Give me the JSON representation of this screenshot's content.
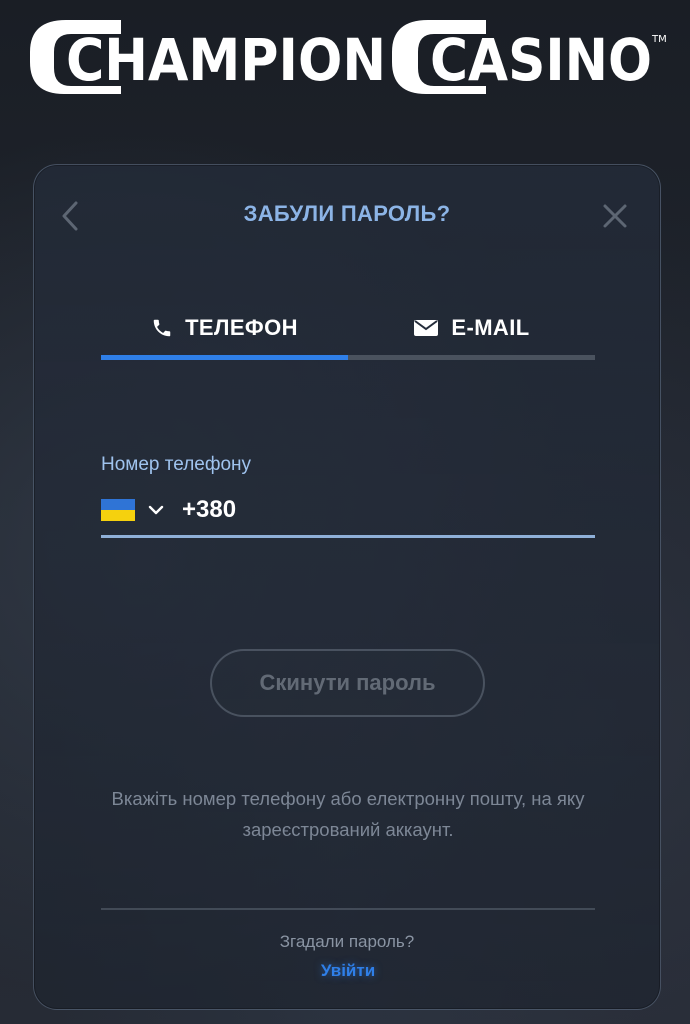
{
  "brand": {
    "logo_text_1": "CHAMPION",
    "logo_text_2": "CASINO",
    "trademark": "TM"
  },
  "modal": {
    "title": "ЗАБУЛИ ПАРОЛЬ?",
    "back_icon": "chevron-left-icon",
    "close_icon": "close-icon"
  },
  "tabs": [
    {
      "label": "ТЕЛЕФОН",
      "icon": "phone-icon",
      "active": true
    },
    {
      "label": "E-MAIL",
      "icon": "envelope-icon",
      "active": false
    }
  ],
  "phone_field": {
    "label": "Номер телефону",
    "country_flag": "ukraine-flag-icon",
    "value": "+380"
  },
  "actions": {
    "reset_label": "Скинути пароль"
  },
  "hint": "Вкажіть номер телефону або електронну пошту, на яку зареєстрований аккаунт.",
  "footer": {
    "remember_text": "Згадали пароль?",
    "login_label": "Увійти"
  },
  "colors": {
    "accent": "#2f7fe8",
    "title": "#8cb4e6",
    "flag_blue": "#2f74d6",
    "flag_yellow": "#f5d10e"
  }
}
